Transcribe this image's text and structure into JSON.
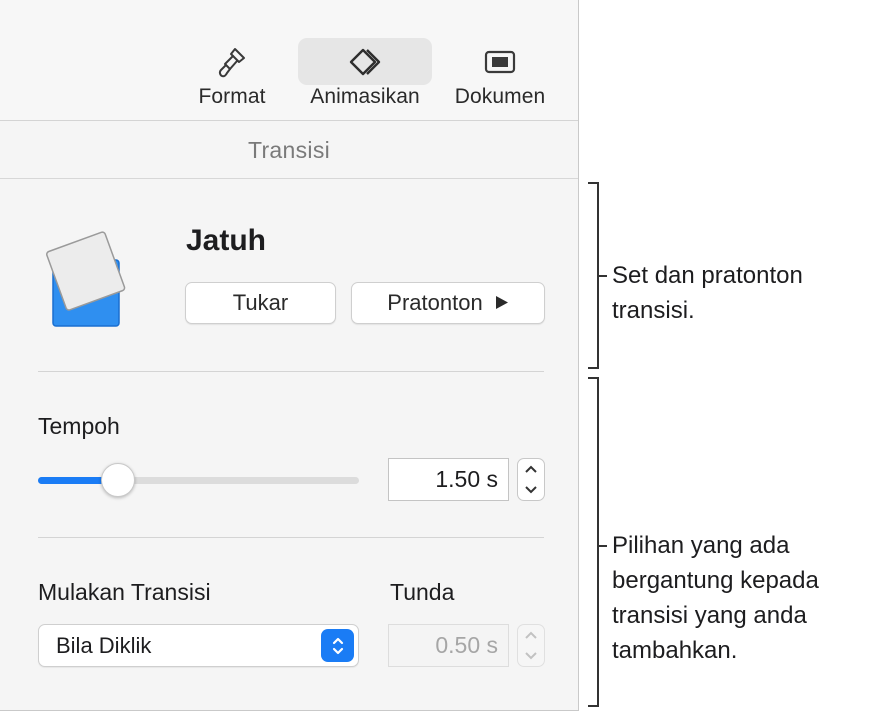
{
  "toolbar": {
    "items": [
      {
        "label": "Format",
        "icon": "paintbrush-icon"
      },
      {
        "label": "Animasikan",
        "icon": "diamond-icon",
        "selected": true
      },
      {
        "label": "Dokumen",
        "icon": "document-icon"
      }
    ]
  },
  "section": {
    "title": "Transisi"
  },
  "transition": {
    "name": "Jatuh",
    "swap_label": "Tukar",
    "preview_label": "Pratonton"
  },
  "duration": {
    "label": "Tempoh",
    "value": "1.50 s",
    "slider_fraction": 0.25
  },
  "start": {
    "label": "Mulakan Transisi",
    "selected": "Bila Diklik"
  },
  "delay": {
    "label": "Tunda",
    "value": "0.50 s",
    "enabled": false
  },
  "annotations": {
    "top_line1": "Set dan pratonton",
    "top_line2": "transisi.",
    "bottom_line1": "Pilihan yang ada",
    "bottom_line2": "bergantung kepada",
    "bottom_line3": "transisi yang anda",
    "bottom_line4": "tambahkan."
  },
  "colors": {
    "accent": "#1a7cf5",
    "panel_bg": "#f5f5f5",
    "thumbnail_blue": "#2f8ff0"
  }
}
